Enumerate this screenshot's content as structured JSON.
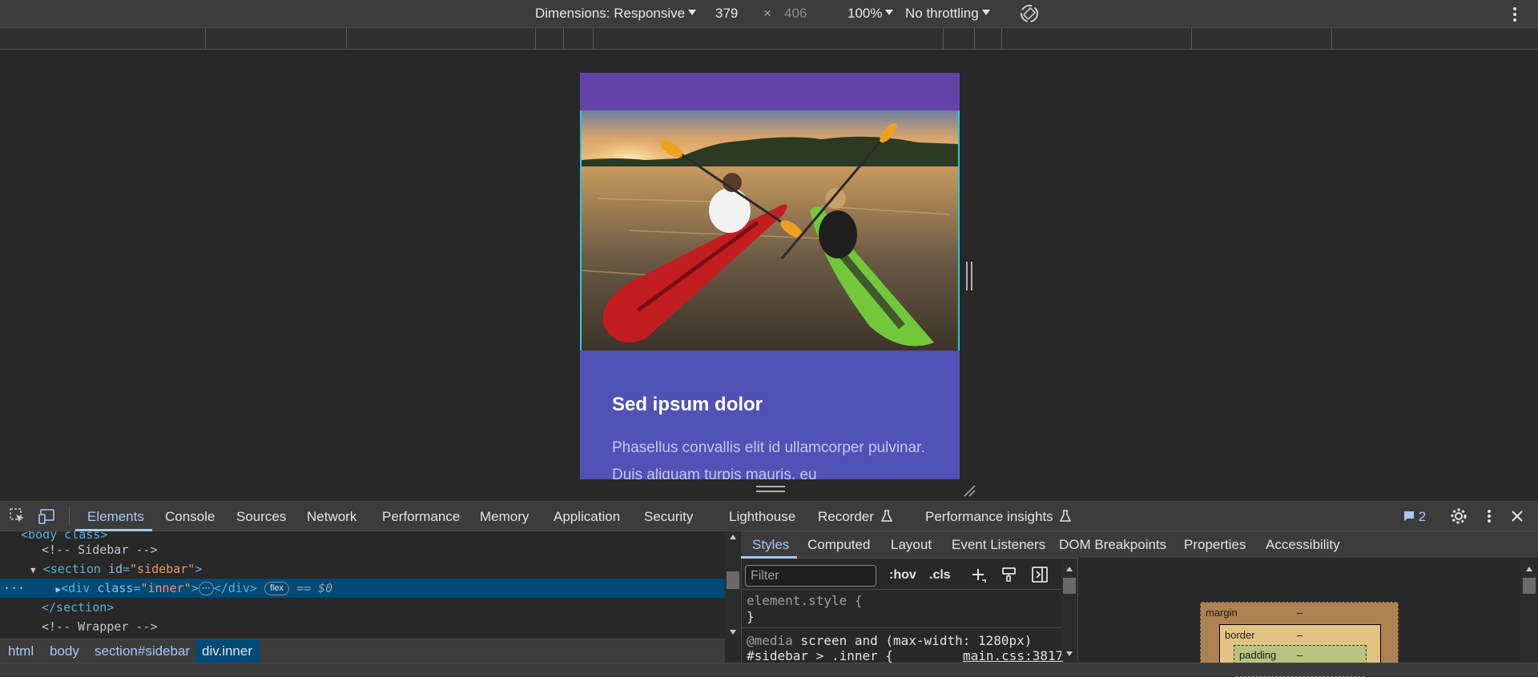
{
  "device_toolbar": {
    "dimensions_label": "Dimensions: Responsive",
    "width_value": "379",
    "times": "×",
    "height_value": "406",
    "zoom": "100%",
    "throttling": "No throttling"
  },
  "viewport": {
    "article_title": "Sed ipsum dolor",
    "article_text": "Phasellus convallis elit id ullamcorper pulvinar. Duis aliquam turpis mauris, eu"
  },
  "devtools": {
    "tabs": [
      "Elements",
      "Console",
      "Sources",
      "Network",
      "Performance",
      "Memory",
      "Application",
      "Security",
      "Lighthouse",
      "Recorder",
      "Performance insights"
    ],
    "issues_count": "2",
    "dom": {
      "line0": "<body class>",
      "comment_sidebar": "<!-- Sidebar -->",
      "section_tag": "section",
      "section_attr": "id",
      "section_val": "\"sidebar\"",
      "div_tag": "div",
      "div_attr": "class",
      "div_val": "\"inner\"",
      "div_close": "</div>",
      "badge": "flex",
      "eq": "== $0",
      "section_close": "</section>",
      "comment_wrapper": "<!-- Wrapper -->"
    },
    "breadcrumbs": [
      "html",
      "body",
      "section#sidebar",
      "div.inner"
    ],
    "styles_tabs": [
      "Styles",
      "Computed",
      "Layout",
      "Event Listeners",
      "DOM Breakpoints",
      "Properties",
      "Accessibility"
    ],
    "filter_placeholder": "Filter",
    "hov": ":hov",
    "cls": ".cls",
    "css": {
      "element_style": "element.style {",
      "close_brace": "}",
      "media_at": "@media",
      "media_rest": " screen and (max-width: 1280px)",
      "selector": "#sidebar > .inner {",
      "source": "main.css:3817"
    },
    "box_model": {
      "margin": "margin",
      "border": "border",
      "padding": "padding",
      "dash": "–"
    }
  }
}
